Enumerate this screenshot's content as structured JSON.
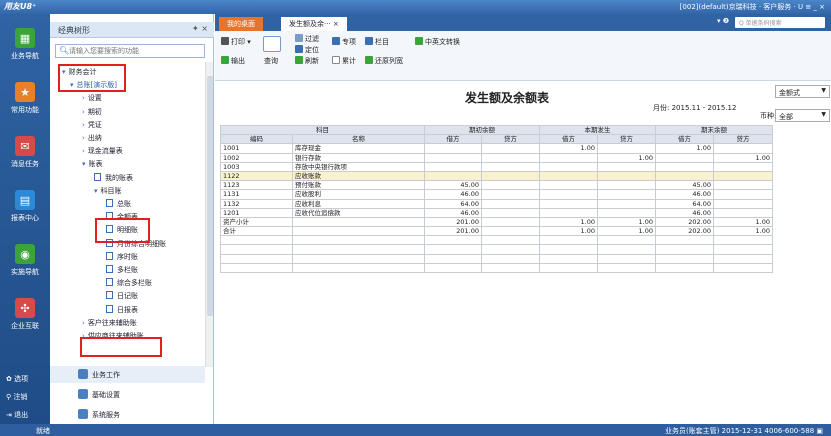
{
  "app": {
    "logo": "用友U8⁺",
    "right_info": "[002](default)京瑞科技  ·  客户服务 ·  U  ≡  _  ×"
  },
  "left_nav": {
    "items": [
      {
        "label": "业务导航",
        "icon": "business-nav-icon",
        "color": "#3aa43a",
        "glyph": "▦"
      },
      {
        "label": "常用功能",
        "icon": "star-icon",
        "color": "#e8802a",
        "glyph": "★"
      },
      {
        "label": "消息任务",
        "icon": "message-icon",
        "color": "#d84a4a",
        "glyph": "✉"
      },
      {
        "label": "报表中心",
        "icon": "report-icon",
        "color": "#2a8ad8",
        "glyph": "▤"
      },
      {
        "label": "实施导航",
        "icon": "implement-icon",
        "color": "#3aa43a",
        "glyph": "◉"
      },
      {
        "label": "企业互联",
        "icon": "connect-icon",
        "color": "#d84a4a",
        "glyph": "✣"
      }
    ],
    "bottom": [
      {
        "label": "选项",
        "icon": "gear-icon",
        "glyph": "✿"
      },
      {
        "label": "注销",
        "icon": "logout-key-icon",
        "glyph": "⚲"
      },
      {
        "label": "退出",
        "icon": "exit-icon",
        "glyph": "⇥"
      }
    ]
  },
  "tree": {
    "header": "经典树形",
    "pin": "✦ ×",
    "search_placeholder": "请输入您要搜索的功能",
    "rows": [
      {
        "label": "财务会计",
        "arrow": "▾",
        "indent": 12,
        "type": "folder"
      },
      {
        "label": "总账[演示版]",
        "arrow": "▾",
        "indent": 20,
        "type": "folder",
        "link": true
      },
      {
        "label": "设置",
        "arrow": "›",
        "indent": 32,
        "type": "folder"
      },
      {
        "label": "期初",
        "arrow": "›",
        "indent": 32,
        "type": "folder"
      },
      {
        "label": "凭证",
        "arrow": "›",
        "indent": 32,
        "type": "folder"
      },
      {
        "label": "出纳",
        "arrow": "›",
        "indent": 32,
        "type": "folder"
      },
      {
        "label": "现金流量表",
        "arrow": "›",
        "indent": 32,
        "type": "folder"
      },
      {
        "label": "账表",
        "arrow": "▾",
        "indent": 32,
        "type": "folder"
      },
      {
        "label": "我的账表",
        "arrow": "",
        "indent": 44,
        "type": "doc"
      },
      {
        "label": "科目账",
        "arrow": "▾",
        "indent": 44,
        "type": "folder"
      },
      {
        "label": "总账",
        "arrow": "",
        "indent": 56,
        "type": "doc"
      },
      {
        "label": "余额表",
        "arrow": "",
        "indent": 56,
        "type": "doc"
      },
      {
        "label": "明细账",
        "arrow": "",
        "indent": 56,
        "type": "doc"
      },
      {
        "label": "月份综合明细账",
        "arrow": "",
        "indent": 56,
        "type": "doc"
      },
      {
        "label": "序时账",
        "arrow": "",
        "indent": 56,
        "type": "doc"
      },
      {
        "label": "多栏账",
        "arrow": "",
        "indent": 56,
        "type": "doc"
      },
      {
        "label": "综合多栏账",
        "arrow": "",
        "indent": 56,
        "type": "doc"
      },
      {
        "label": "日记账",
        "arrow": "",
        "indent": 56,
        "type": "doc"
      },
      {
        "label": "日报表",
        "arrow": "",
        "indent": 56,
        "type": "doc"
      },
      {
        "label": "客户往来辅助账",
        "arrow": "›",
        "indent": 32,
        "type": "folder"
      },
      {
        "label": "供应商往来辅助账",
        "arrow": "›",
        "indent": 32,
        "type": "folder"
      }
    ],
    "bottom_items": [
      {
        "label": "业务工作",
        "icon": "work-icon"
      },
      {
        "label": "基础设置",
        "icon": "settings-icon"
      },
      {
        "label": "系统服务",
        "icon": "service-icon"
      }
    ]
  },
  "tabs": [
    {
      "label": "我的桌面",
      "active": false
    },
    {
      "label": "发生额及余··· ×",
      "active": true
    }
  ],
  "tab_bar": {
    "search_placeholder": "Q 单据条码搜索",
    "controls": "▾ ❷"
  },
  "toolbar": {
    "print": "打印 ▾",
    "output": "输出",
    "query": "查询",
    "filter": "过滤",
    "locate": "定位",
    "refresh": "刷新",
    "special": "专项",
    "cumulative": "累计",
    "columns": "栏目",
    "restore": "还原列宽",
    "cn_en": "中英文转换"
  },
  "report": {
    "title": "发生额及余额表",
    "month_label": "月份: 2015.11 - 2015.12",
    "format": "金额式",
    "currency_label": "币种:",
    "currency": "全部"
  },
  "table": {
    "header_groups": [
      "科目",
      "期初余额",
      "本期发生",
      "期末余额"
    ],
    "sub_headers": [
      "编码",
      "名称",
      "借方",
      "贷方",
      "借方",
      "贷方",
      "借方",
      "贷方"
    ],
    "rows": [
      [
        "1001",
        "库存现金",
        "",
        "",
        "1.00",
        "",
        "1.00",
        ""
      ],
      [
        "1002",
        "银行存款",
        "",
        "",
        "",
        "1.00",
        "",
        "1.00"
      ],
      [
        "1003",
        "存放中央银行款项",
        "",
        "",
        "",
        "",
        "",
        ""
      ],
      [
        "1122",
        "应收账款",
        "",
        "",
        "",
        "",
        "",
        ""
      ],
      [
        "1123",
        "预付账款",
        "45.00",
        "",
        "",
        "",
        "45.00",
        ""
      ],
      [
        "1131",
        "应收股利",
        "46.00",
        "",
        "",
        "",
        "46.00",
        ""
      ],
      [
        "1132",
        "应收利息",
        "64.00",
        "",
        "",
        "",
        "64.00",
        ""
      ],
      [
        "1201",
        "应收代位追偿款",
        "46.00",
        "",
        "",
        "",
        "46.00",
        ""
      ],
      [
        "资产小计",
        "",
        "201.00",
        "",
        "1.00",
        "1.00",
        "202.00",
        "1.00"
      ],
      [
        "合计",
        "",
        "201.00",
        "",
        "1.00",
        "1.00",
        "202.00",
        "1.00"
      ]
    ],
    "selected_row": 3,
    "empty_rows": 4
  },
  "status": {
    "left": "就绪",
    "right": "业务员(账套主管)    2015-12-31    4006-600-588    ▣"
  }
}
